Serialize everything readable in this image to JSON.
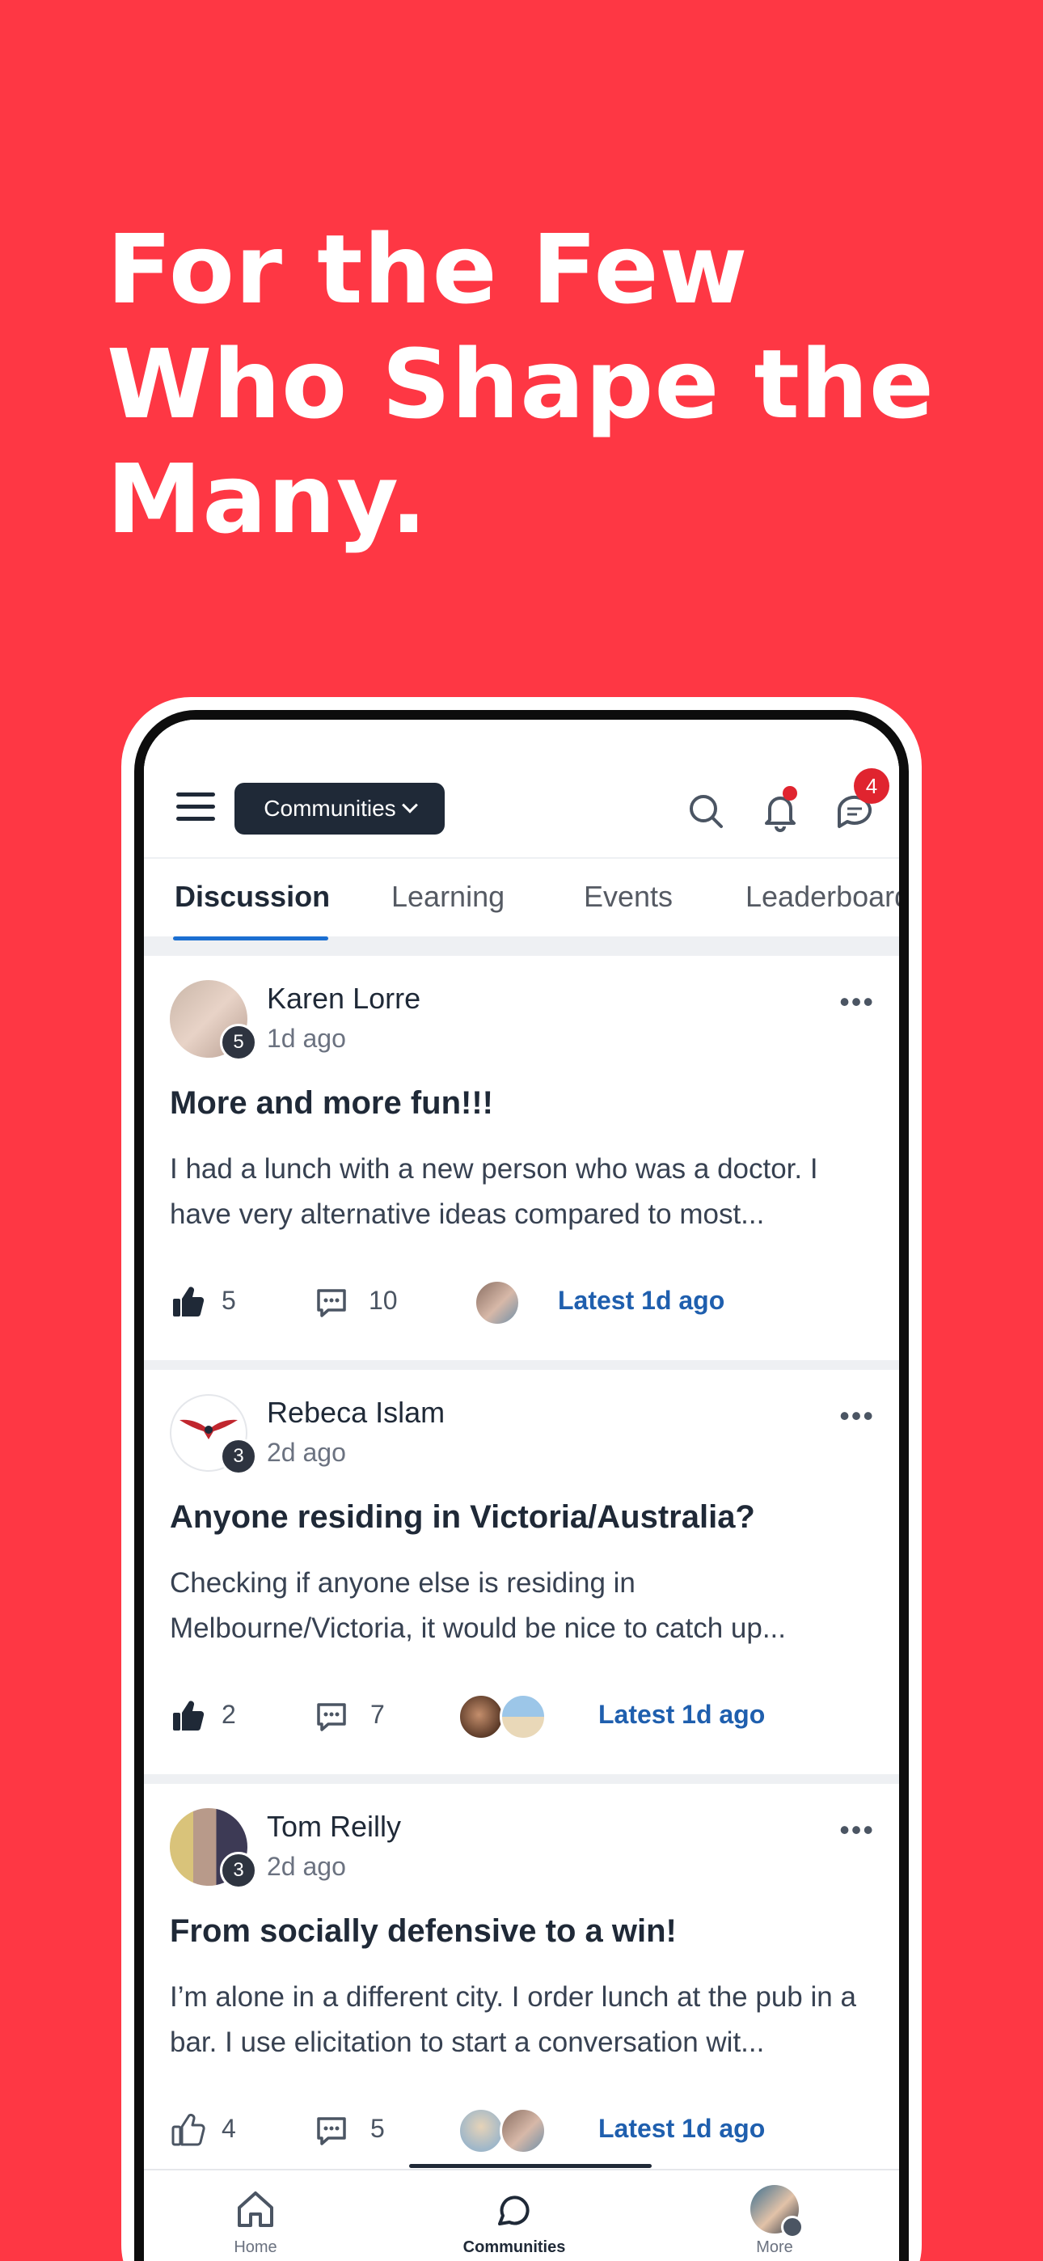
{
  "headline": {
    "line1": "For the Few",
    "line2": "Who Shape the",
    "line3": "Many."
  },
  "topbar": {
    "communities_label": "Communities",
    "messages_badge": "4"
  },
  "tabs": [
    {
      "label": "Discussion",
      "active": true
    },
    {
      "label": "Learning"
    },
    {
      "label": "Events"
    },
    {
      "label": "Leaderboard"
    }
  ],
  "posts": [
    {
      "author": "Karen Lorre",
      "level": "5",
      "time": "1d ago",
      "title": "More and more fun!!!",
      "body": "I had a lunch with a new person who was a doctor. I have very alternative ideas compared to most...",
      "likes": "5",
      "comments": "10",
      "latest": "Latest 1d ago"
    },
    {
      "author": "Rebeca Islam",
      "level": "3",
      "time": "2d ago",
      "title": "Anyone residing in Victoria/Australia?",
      "body": "Checking if anyone else is residing in Melbourne/Victoria, it would be nice to catch up...",
      "likes": "2",
      "comments": "7",
      "latest": "Latest 1d ago"
    },
    {
      "author": "Tom Reilly",
      "level": "3",
      "time": "2d ago",
      "title": "From socially defensive to a win!",
      "body": "I’m alone in a different city. I order lunch at the pub in a bar. I use elicitation to start a conversation wit...",
      "likes": "4",
      "comments": "5",
      "latest": "Latest 1d ago"
    }
  ],
  "navbar": {
    "home": "Home",
    "communities": "Communities",
    "more": "More"
  },
  "colors": {
    "background": "#fe3744",
    "accent": "#1b6fd1",
    "link": "#1f5fae",
    "dark": "#1f2937"
  }
}
